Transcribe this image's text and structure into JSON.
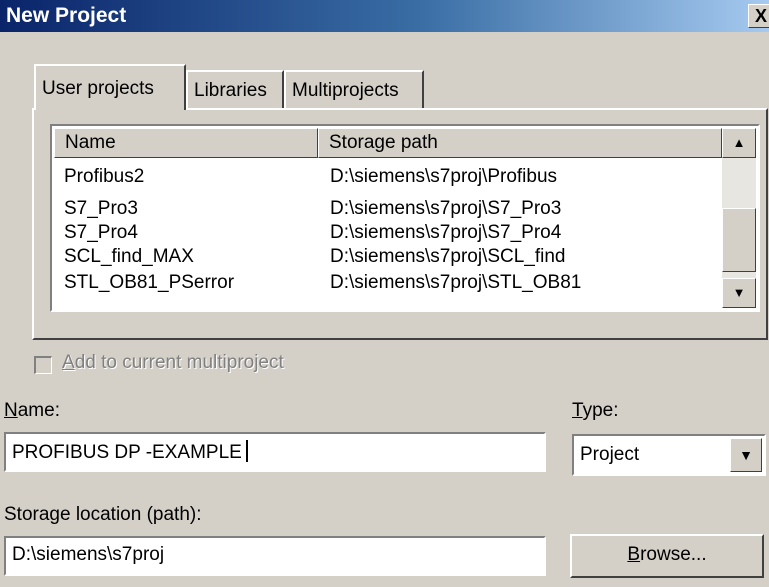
{
  "window": {
    "title": "New Project",
    "close_label": "X"
  },
  "tabs": [
    {
      "label": "User projects",
      "active": true
    },
    {
      "label": "Libraries",
      "active": false
    },
    {
      "label": "Multiprojects",
      "active": false
    }
  ],
  "project_list": {
    "columns": [
      "Name",
      "Storage path"
    ],
    "rows": [
      {
        "name": "Profibus2",
        "path": "D:\\siemens\\s7proj\\Profibus"
      },
      {
        "name": "S7_Pro3",
        "path": "D:\\siemens\\s7proj\\S7_Pro3"
      },
      {
        "name": "S7_Pro4",
        "path": "D:\\siemens\\s7proj\\S7_Pro4"
      },
      {
        "name": "SCL_find_MAX",
        "path": "D:\\siemens\\s7proj\\SCL_find"
      },
      {
        "name": "STL_OB81_PSerror",
        "path": "D:\\siemens\\s7proj\\STL_OB81"
      }
    ],
    "scroll_up_icon": "▲",
    "scroll_down_icon": "▼"
  },
  "multiproject_checkbox": {
    "label_first": "A",
    "label_rest": "dd to current multiproject",
    "checked": false,
    "enabled": false
  },
  "name_field": {
    "label_first": "N",
    "label_rest": "ame:",
    "value": "PROFIBUS DP -EXAMPLE"
  },
  "type_field": {
    "label_first": "T",
    "label_rest": "ype:",
    "value": "Project",
    "arrow": "▼"
  },
  "storage_field": {
    "label": "Storage location (path):",
    "value": "D:\\siemens\\s7proj"
  },
  "browse_button": {
    "label_first": "B",
    "label_rest": "rowse..."
  }
}
